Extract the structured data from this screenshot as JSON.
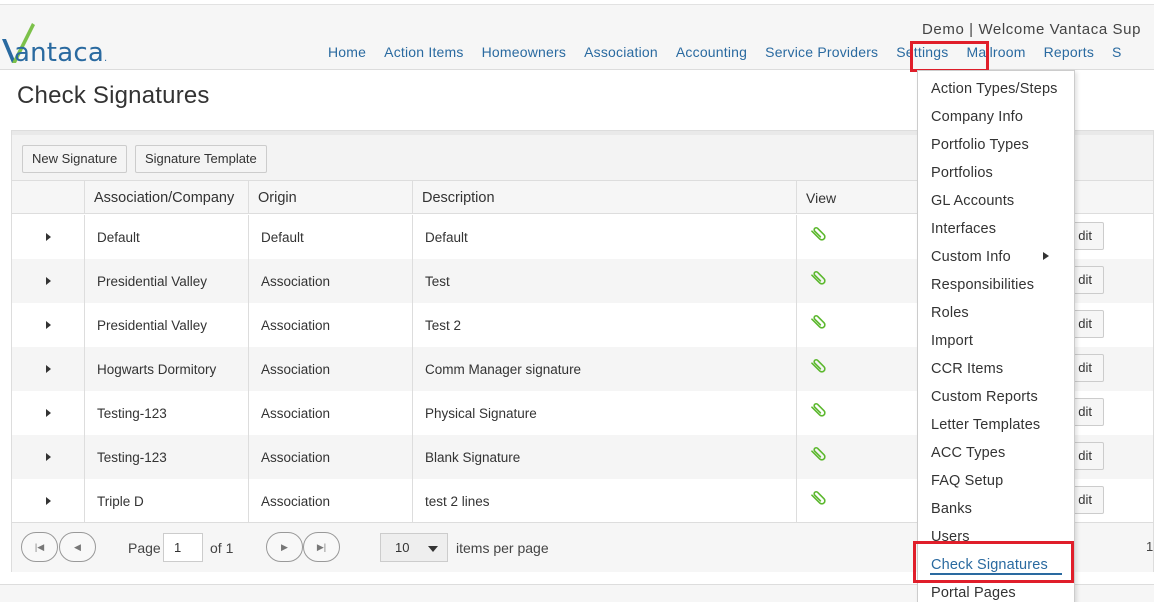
{
  "header": {
    "logo_text": "Vantaca",
    "welcome": "Demo | Welcome Vantaca Sup",
    "nav": [
      "Home",
      "Action Items",
      "Homeowners",
      "Association",
      "Accounting",
      "Service Providers",
      "Settings",
      "Mailroom",
      "Reports",
      "S"
    ]
  },
  "page": {
    "title": "Check Signatures"
  },
  "toolbar": {
    "new_signature": "New Signature",
    "signature_template": "Signature Template"
  },
  "table": {
    "columns": [
      "Association/Company",
      "Origin",
      "Description",
      "View"
    ],
    "edit_label": "dit",
    "rows": [
      {
        "company": "Default",
        "origin": "Default",
        "description": "Default"
      },
      {
        "company": "Presidential Valley",
        "origin": "Association",
        "description": "Test"
      },
      {
        "company": "Presidential Valley",
        "origin": "Association",
        "description": "Test 2"
      },
      {
        "company": "Hogwarts Dormitory",
        "origin": "Association",
        "description": "Comm Manager signature"
      },
      {
        "company": "Testing-123",
        "origin": "Association",
        "description": "Physical Signature"
      },
      {
        "company": "Testing-123",
        "origin": "Association",
        "description": "Blank Signature"
      },
      {
        "company": "Triple D",
        "origin": "Association",
        "description": "test 2 lines"
      }
    ]
  },
  "pager": {
    "page_label": "Page",
    "page_value": "1",
    "of_label": "of 1",
    "page_size": "10",
    "items_per_page": "items per page",
    "right_count": "1"
  },
  "settings_menu": {
    "items": [
      "Action Types/Steps",
      "Company Info",
      "Portfolio Types",
      "Portfolios",
      "GL Accounts",
      "Interfaces",
      "Custom Info",
      "Responsibilities",
      "Roles",
      "Import",
      "CCR Items",
      "Custom Reports",
      "Letter Templates",
      "ACC Types",
      "FAQ Setup",
      "Banks",
      "Users",
      "Check Signatures",
      "Portal Pages"
    ],
    "active": "Check Signatures"
  },
  "colors": {
    "link": "#2a6aa0",
    "highlight": "#e01e2a",
    "logo_green": "#7cc14a",
    "clip_green": "#5cb82e"
  }
}
